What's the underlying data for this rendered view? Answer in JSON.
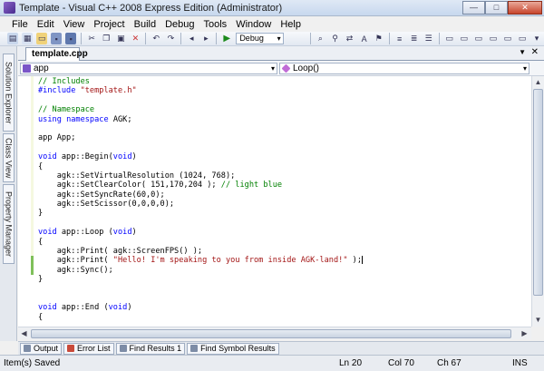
{
  "window": {
    "title": "Template - Visual C++ 2008 Express Edition (Administrator)"
  },
  "menu": [
    "File",
    "Edit",
    "View",
    "Project",
    "Build",
    "Debug",
    "Tools",
    "Window",
    "Help"
  ],
  "toolbar": {
    "config": "Debug"
  },
  "side_tabs": [
    "Solution Explorer",
    "Class View",
    "Property Manager"
  ],
  "document_tab": {
    "label": "template.cpp"
  },
  "nav": {
    "scope": "app",
    "member": "Loop()"
  },
  "code_lines": [
    [
      {
        "c": "cm",
        "t": "// Includes"
      }
    ],
    [
      {
        "c": "kw",
        "t": "#include"
      },
      {
        "c": "st",
        "t": " \"template.h\""
      }
    ],
    [],
    [
      {
        "c": "cm",
        "t": "// Namespace"
      }
    ],
    [
      {
        "c": "kw",
        "t": "using"
      },
      {
        "c": "",
        "t": " "
      },
      {
        "c": "kw",
        "t": "namespace"
      },
      {
        "c": "",
        "t": " AGK;"
      }
    ],
    [],
    [
      {
        "c": "",
        "t": "app App;"
      }
    ],
    [],
    [
      {
        "c": "kw",
        "t": "void"
      },
      {
        "c": "",
        "t": " app::Begin("
      },
      {
        "c": "kw",
        "t": "void"
      },
      {
        "c": "",
        "t": ")"
      }
    ],
    [
      {
        "c": "",
        "t": "{"
      }
    ],
    [
      {
        "c": "",
        "t": "    agk::SetVirtualResolution (1024, 768);"
      }
    ],
    [
      {
        "c": "",
        "t": "    agk::SetClearColor( 151,170,204 ); "
      },
      {
        "c": "cm",
        "t": "// light blue"
      }
    ],
    [
      {
        "c": "",
        "t": "    agk::SetSyncRate(60,0);"
      }
    ],
    [
      {
        "c": "",
        "t": "    agk::SetScissor(0,0,0,0);"
      }
    ],
    [
      {
        "c": "",
        "t": "}"
      }
    ],
    [],
    [
      {
        "c": "kw",
        "t": "void"
      },
      {
        "c": "",
        "t": " app::Loop ("
      },
      {
        "c": "kw",
        "t": "void"
      },
      {
        "c": "",
        "t": ")"
      }
    ],
    [
      {
        "c": "",
        "t": "{"
      }
    ],
    [
      {
        "c": "",
        "t": "    agk::Print( agk::ScreenFPS() );"
      }
    ],
    [
      {
        "c": "",
        "t": "    agk::Print( "
      },
      {
        "c": "st",
        "t": "\"Hello! I'm speaking to you from inside AGK-land!\""
      },
      {
        "c": "",
        "t": " );"
      },
      {
        "c": "caret",
        "t": ""
      }
    ],
    [
      {
        "c": "",
        "t": "    agk::Sync();"
      }
    ],
    [
      {
        "c": "",
        "t": "}"
      }
    ],
    [],
    [],
    [
      {
        "c": "kw",
        "t": "void"
      },
      {
        "c": "",
        "t": " app::End ("
      },
      {
        "c": "kw",
        "t": "void"
      },
      {
        "c": "",
        "t": ")"
      }
    ],
    [
      {
        "c": "",
        "t": "{"
      }
    ]
  ],
  "bottom_tabs": [
    "Output",
    "Error List",
    "Find Results 1",
    "Find Symbol Results"
  ],
  "status": {
    "message": "Item(s) Saved",
    "ln": "Ln 20",
    "col": "Col 70",
    "ch": "Ch 67",
    "mode": "INS"
  }
}
